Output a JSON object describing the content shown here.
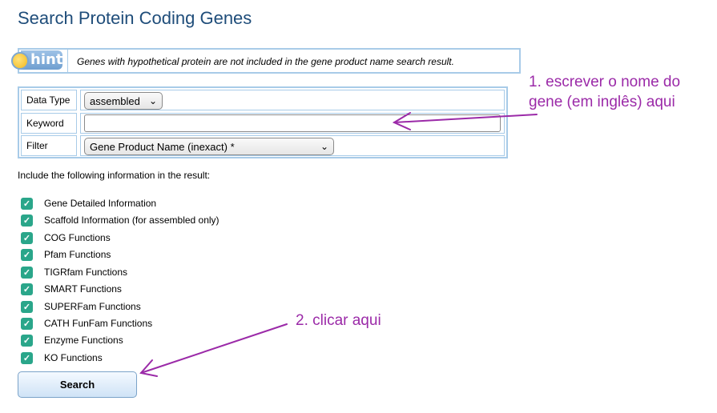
{
  "page": {
    "title": "Search Protein Coding Genes"
  },
  "hint": {
    "badge": "hint:",
    "text": "Genes with hypothetical protein are not included in the gene product name search result."
  },
  "form": {
    "data_type": {
      "label": "Data Type",
      "value": "assembled"
    },
    "keyword": {
      "label": "Keyword",
      "value": ""
    },
    "filter": {
      "label": "Filter",
      "value": "Gene Product Name (inexact) *"
    }
  },
  "include_label": "Include the following information in the result:",
  "options": [
    {
      "label": "Gene Detailed Information",
      "checked": true
    },
    {
      "label": "Scaffold Information (for assembled only)",
      "checked": true
    },
    {
      "label": "COG Functions",
      "checked": true
    },
    {
      "label": "Pfam Functions",
      "checked": true
    },
    {
      "label": "TIGRfam Functions",
      "checked": true
    },
    {
      "label": "SMART Functions",
      "checked": true
    },
    {
      "label": "SUPERFam Functions",
      "checked": true
    },
    {
      "label": "CATH FunFam Functions",
      "checked": true
    },
    {
      "label": "Enzyme Functions",
      "checked": true
    },
    {
      "label": "KO Functions",
      "checked": true
    }
  ],
  "search_button": "Search",
  "annotations": {
    "step1_line1": "1. escrever o nome do",
    "step1_line2": "gene (em inglês) aqui",
    "step2": "2. clicar aqui"
  },
  "colors": {
    "title": "#1f4d7a",
    "border": "#a8cbe8",
    "checkbox": "#2aa68a",
    "annotation": "#9b2aa8"
  }
}
